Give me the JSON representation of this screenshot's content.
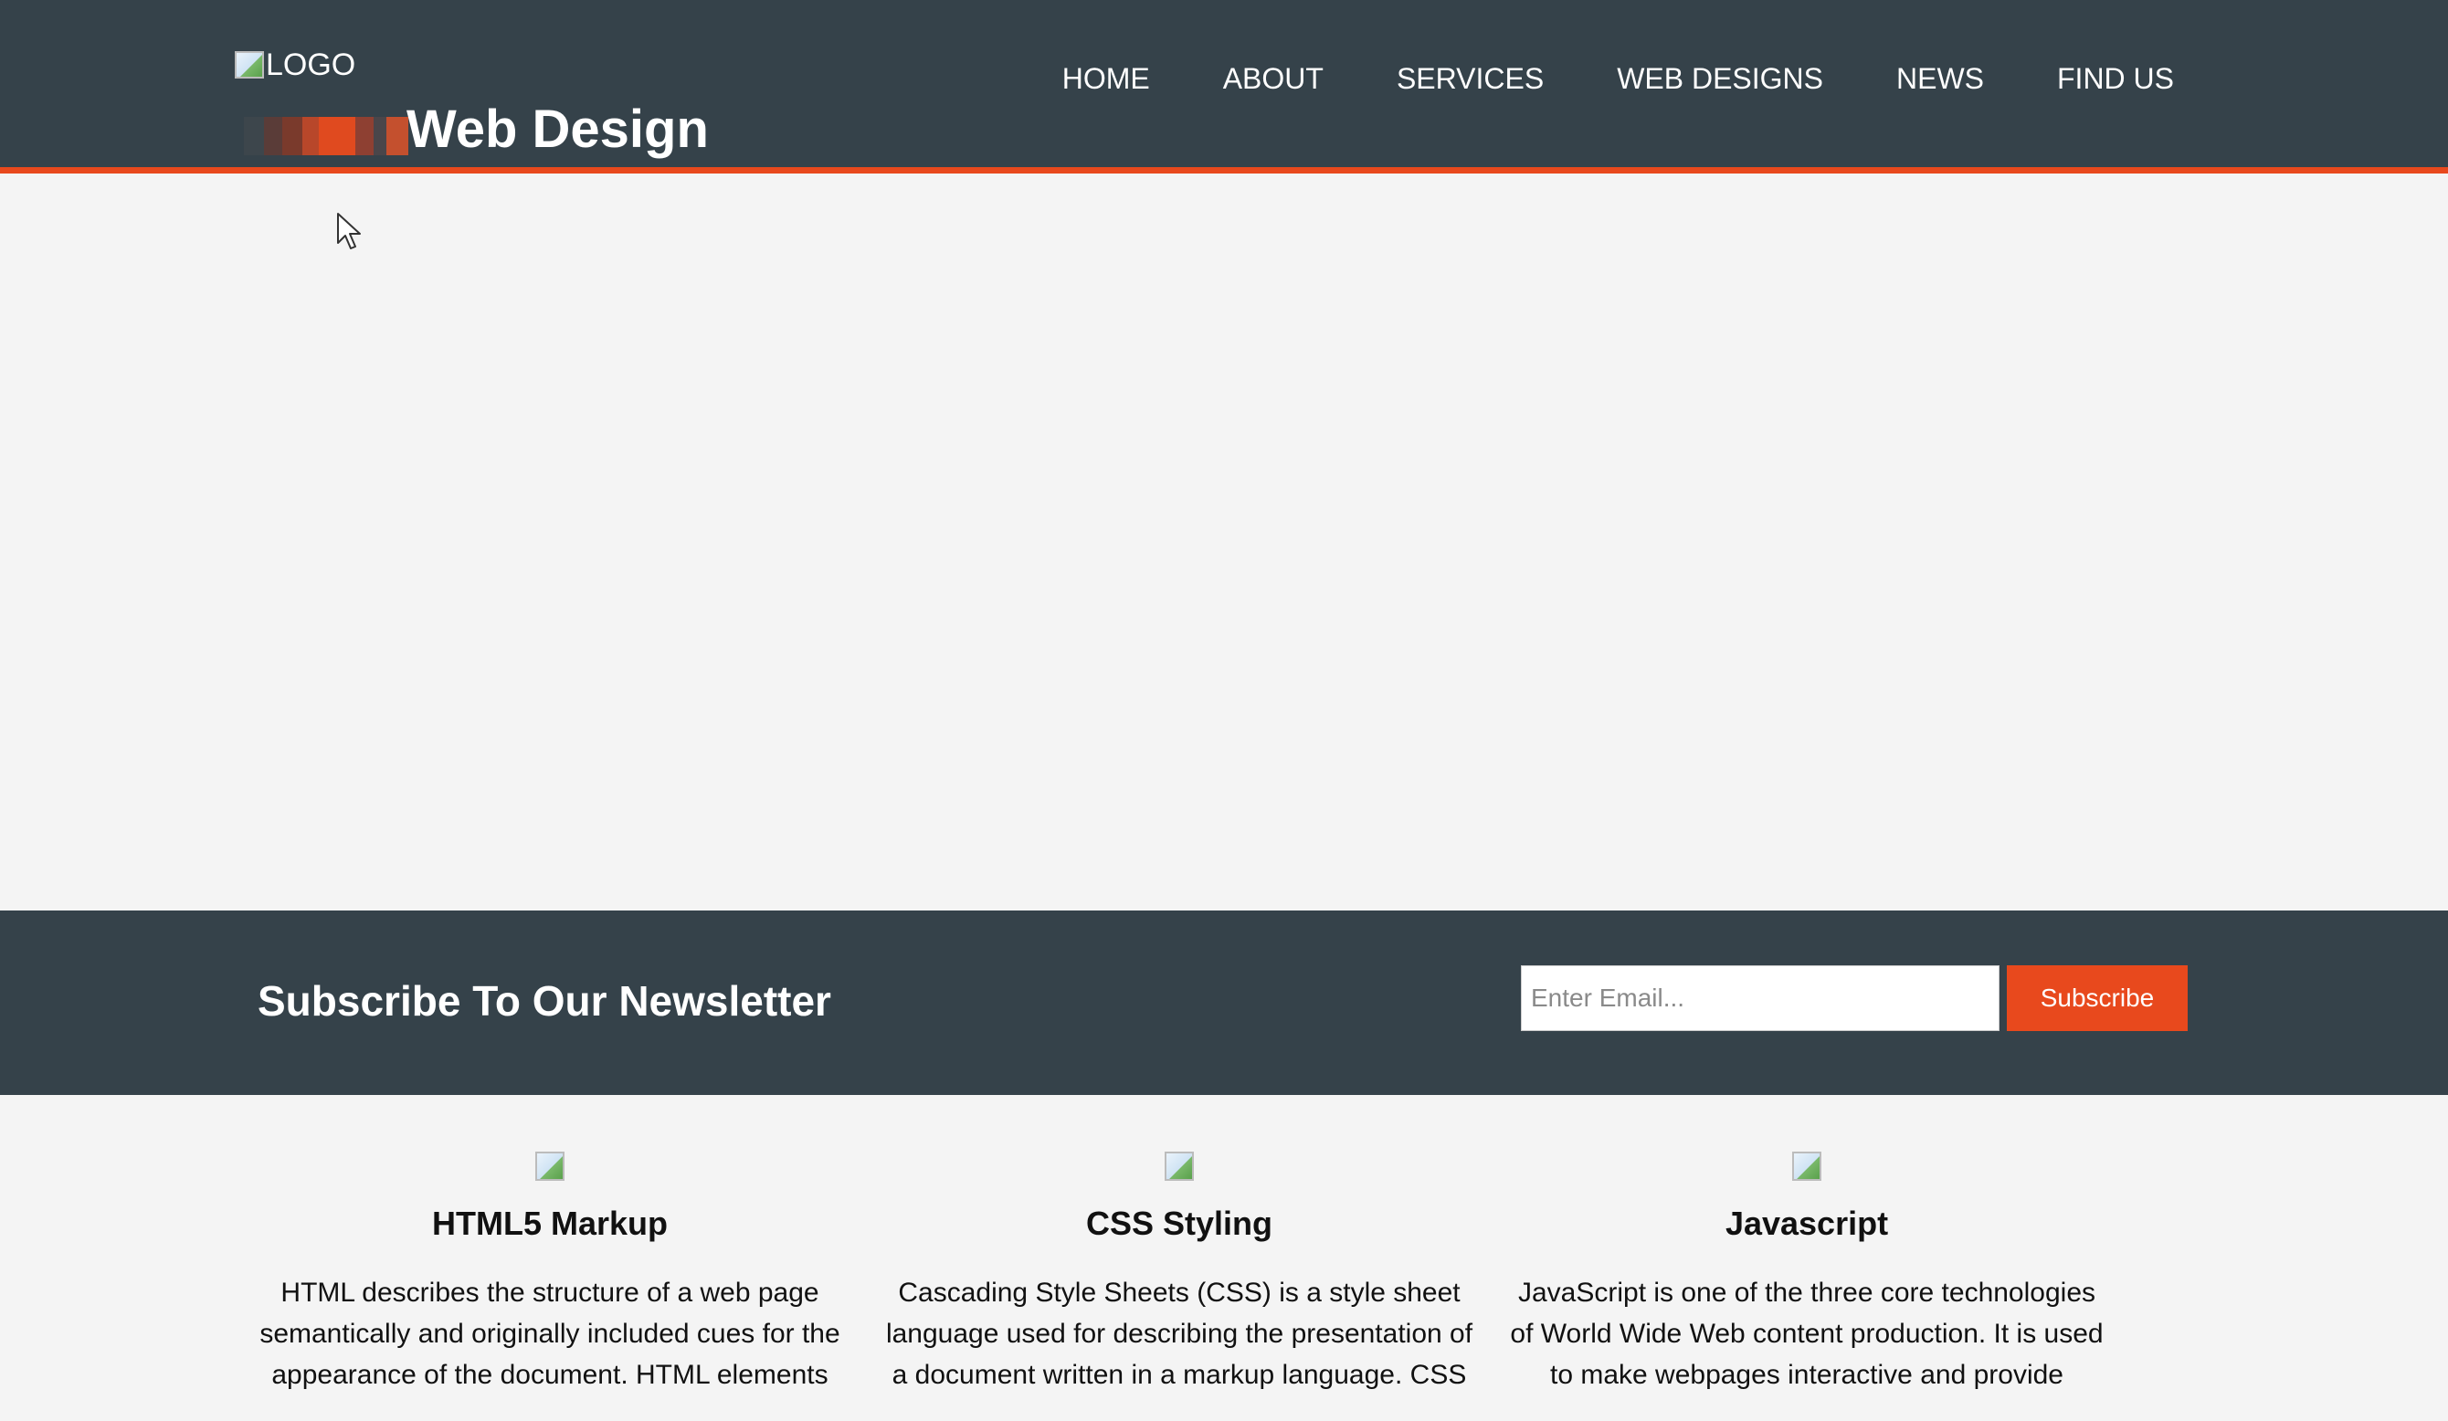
{
  "header": {
    "logo_alt": "LOGO",
    "title": "Web Design",
    "nav": [
      {
        "label": "HOME"
      },
      {
        "label": "ABOUT"
      },
      {
        "label": "SERVICES"
      },
      {
        "label": "WEB DESIGNS"
      },
      {
        "label": "NEWS"
      },
      {
        "label": "FIND US"
      }
    ]
  },
  "colors": {
    "header_bg": "#35424a",
    "accent": "#e8491d",
    "page_bg": "#f4f4f4"
  },
  "newsletter": {
    "heading": "Subscribe To Our Newsletter",
    "email_placeholder": "Enter Email...",
    "button_label": "Subscribe"
  },
  "boxes": [
    {
      "title": "HTML5 Markup",
      "text": "HTML describes the structure of a web page semantically and originally included cues for the appearance of the document. HTML elements"
    },
    {
      "title": "CSS Styling",
      "text": "Cascading Style Sheets (CSS) is a style sheet language used for describing the presentation of a document written in a markup language. CSS"
    },
    {
      "title": "Javascript",
      "text": "JavaScript is one of the three core technologies of World Wide Web content production. It is used to make webpages interactive and provide"
    }
  ]
}
